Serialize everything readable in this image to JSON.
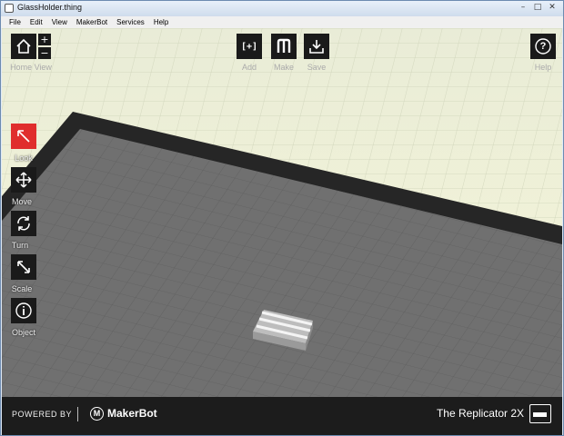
{
  "window": {
    "title": "GlassHolder.thing",
    "controls": [
      "–",
      "□",
      "✕"
    ]
  },
  "menu": [
    "File",
    "Edit",
    "View",
    "MakerBot",
    "Services",
    "Help"
  ],
  "toolbar": {
    "home_label": "Home View",
    "zoom_in": "+",
    "zoom_out": "−",
    "add_label": "Add",
    "add_icon_text": "[+]",
    "make_label": "Make",
    "save_label": "Save",
    "help_label": "Help",
    "help_icon_text": "?"
  },
  "tools": [
    {
      "label": "Look",
      "icon": "look-arrow-icon",
      "active": true
    },
    {
      "label": "Move",
      "icon": "move-arrows-icon",
      "active": false
    },
    {
      "label": "Turn",
      "icon": "turn-rotate-icon",
      "active": false
    },
    {
      "label": "Scale",
      "icon": "scale-diagonal-icon",
      "active": false
    },
    {
      "label": "Object",
      "icon": "info-icon",
      "active": false
    }
  ],
  "footer": {
    "powered_by": "POWERED BY",
    "brand_logo": "M",
    "brand_name": "MakerBot",
    "printer_name": "The Replicator 2X"
  },
  "colors": {
    "active_tool": "#e02d2d",
    "toolbar_bg": "#1a1a1a",
    "footer_bg": "#1c1c1c",
    "plate": "#707070",
    "backdrop": "#eef1dc"
  }
}
